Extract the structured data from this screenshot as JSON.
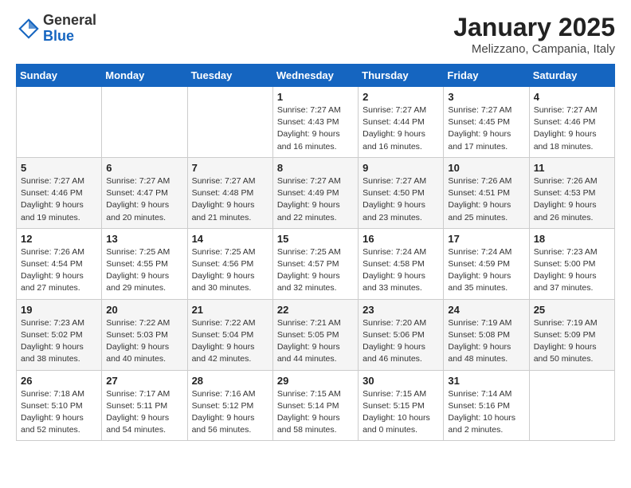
{
  "logo": {
    "general": "General",
    "blue": "Blue"
  },
  "header": {
    "month": "January 2025",
    "location": "Melizzano, Campania, Italy"
  },
  "weekdays": [
    "Sunday",
    "Monday",
    "Tuesday",
    "Wednesday",
    "Thursday",
    "Friday",
    "Saturday"
  ],
  "weeks": [
    [
      {
        "day": "",
        "info": ""
      },
      {
        "day": "",
        "info": ""
      },
      {
        "day": "",
        "info": ""
      },
      {
        "day": "1",
        "info": "Sunrise: 7:27 AM\nSunset: 4:43 PM\nDaylight: 9 hours\nand 16 minutes."
      },
      {
        "day": "2",
        "info": "Sunrise: 7:27 AM\nSunset: 4:44 PM\nDaylight: 9 hours\nand 16 minutes."
      },
      {
        "day": "3",
        "info": "Sunrise: 7:27 AM\nSunset: 4:45 PM\nDaylight: 9 hours\nand 17 minutes."
      },
      {
        "day": "4",
        "info": "Sunrise: 7:27 AM\nSunset: 4:46 PM\nDaylight: 9 hours\nand 18 minutes."
      }
    ],
    [
      {
        "day": "5",
        "info": "Sunrise: 7:27 AM\nSunset: 4:46 PM\nDaylight: 9 hours\nand 19 minutes."
      },
      {
        "day": "6",
        "info": "Sunrise: 7:27 AM\nSunset: 4:47 PM\nDaylight: 9 hours\nand 20 minutes."
      },
      {
        "day": "7",
        "info": "Sunrise: 7:27 AM\nSunset: 4:48 PM\nDaylight: 9 hours\nand 21 minutes."
      },
      {
        "day": "8",
        "info": "Sunrise: 7:27 AM\nSunset: 4:49 PM\nDaylight: 9 hours\nand 22 minutes."
      },
      {
        "day": "9",
        "info": "Sunrise: 7:27 AM\nSunset: 4:50 PM\nDaylight: 9 hours\nand 23 minutes."
      },
      {
        "day": "10",
        "info": "Sunrise: 7:26 AM\nSunset: 4:51 PM\nDaylight: 9 hours\nand 25 minutes."
      },
      {
        "day": "11",
        "info": "Sunrise: 7:26 AM\nSunset: 4:53 PM\nDaylight: 9 hours\nand 26 minutes."
      }
    ],
    [
      {
        "day": "12",
        "info": "Sunrise: 7:26 AM\nSunset: 4:54 PM\nDaylight: 9 hours\nand 27 minutes."
      },
      {
        "day": "13",
        "info": "Sunrise: 7:25 AM\nSunset: 4:55 PM\nDaylight: 9 hours\nand 29 minutes."
      },
      {
        "day": "14",
        "info": "Sunrise: 7:25 AM\nSunset: 4:56 PM\nDaylight: 9 hours\nand 30 minutes."
      },
      {
        "day": "15",
        "info": "Sunrise: 7:25 AM\nSunset: 4:57 PM\nDaylight: 9 hours\nand 32 minutes."
      },
      {
        "day": "16",
        "info": "Sunrise: 7:24 AM\nSunset: 4:58 PM\nDaylight: 9 hours\nand 33 minutes."
      },
      {
        "day": "17",
        "info": "Sunrise: 7:24 AM\nSunset: 4:59 PM\nDaylight: 9 hours\nand 35 minutes."
      },
      {
        "day": "18",
        "info": "Sunrise: 7:23 AM\nSunset: 5:00 PM\nDaylight: 9 hours\nand 37 minutes."
      }
    ],
    [
      {
        "day": "19",
        "info": "Sunrise: 7:23 AM\nSunset: 5:02 PM\nDaylight: 9 hours\nand 38 minutes."
      },
      {
        "day": "20",
        "info": "Sunrise: 7:22 AM\nSunset: 5:03 PM\nDaylight: 9 hours\nand 40 minutes."
      },
      {
        "day": "21",
        "info": "Sunrise: 7:22 AM\nSunset: 5:04 PM\nDaylight: 9 hours\nand 42 minutes."
      },
      {
        "day": "22",
        "info": "Sunrise: 7:21 AM\nSunset: 5:05 PM\nDaylight: 9 hours\nand 44 minutes."
      },
      {
        "day": "23",
        "info": "Sunrise: 7:20 AM\nSunset: 5:06 PM\nDaylight: 9 hours\nand 46 minutes."
      },
      {
        "day": "24",
        "info": "Sunrise: 7:19 AM\nSunset: 5:08 PM\nDaylight: 9 hours\nand 48 minutes."
      },
      {
        "day": "25",
        "info": "Sunrise: 7:19 AM\nSunset: 5:09 PM\nDaylight: 9 hours\nand 50 minutes."
      }
    ],
    [
      {
        "day": "26",
        "info": "Sunrise: 7:18 AM\nSunset: 5:10 PM\nDaylight: 9 hours\nand 52 minutes."
      },
      {
        "day": "27",
        "info": "Sunrise: 7:17 AM\nSunset: 5:11 PM\nDaylight: 9 hours\nand 54 minutes."
      },
      {
        "day": "28",
        "info": "Sunrise: 7:16 AM\nSunset: 5:12 PM\nDaylight: 9 hours\nand 56 minutes."
      },
      {
        "day": "29",
        "info": "Sunrise: 7:15 AM\nSunset: 5:14 PM\nDaylight: 9 hours\nand 58 minutes."
      },
      {
        "day": "30",
        "info": "Sunrise: 7:15 AM\nSunset: 5:15 PM\nDaylight: 10 hours\nand 0 minutes."
      },
      {
        "day": "31",
        "info": "Sunrise: 7:14 AM\nSunset: 5:16 PM\nDaylight: 10 hours\nand 2 minutes."
      },
      {
        "day": "",
        "info": ""
      }
    ]
  ],
  "colors": {
    "header_bg": "#1565c0",
    "even_row": "#f5f5f5",
    "odd_row": "#ffffff"
  }
}
